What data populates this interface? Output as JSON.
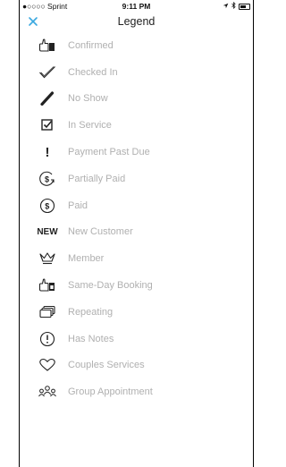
{
  "status_bar": {
    "carrier": "●○○○○ Sprint",
    "time": "9:11 PM"
  },
  "header": {
    "title": "Legend",
    "close_icon": "close-icon"
  },
  "legend": {
    "items": [
      {
        "label": "Confirmed",
        "icon": "thumbs-up-icon"
      },
      {
        "label": "Checked In",
        "icon": "checkmark-icon"
      },
      {
        "label": "No Show",
        "icon": "slash-icon"
      },
      {
        "label": "In Service",
        "icon": "checkbox-icon"
      },
      {
        "label": "Payment Past Due",
        "icon": "exclamation-icon"
      },
      {
        "label": "Partially Paid",
        "icon": "partial-dollar-icon"
      },
      {
        "label": "Paid",
        "icon": "dollar-circle-icon"
      },
      {
        "label": "New Customer",
        "icon": "new-badge-icon",
        "badge": "NEW"
      },
      {
        "label": "Member",
        "icon": "crown-icon"
      },
      {
        "label": "Same-Day Booking",
        "icon": "same-day-thumbs-icon"
      },
      {
        "label": "Repeating",
        "icon": "stacked-cards-icon"
      },
      {
        "label": "Has Notes",
        "icon": "notes-alert-icon"
      },
      {
        "label": "Couples Services",
        "icon": "heart-icon"
      },
      {
        "label": "Group Appointment",
        "icon": "group-people-icon"
      }
    ]
  },
  "colors": {
    "accent": "#3aa8e0",
    "label": "#b0b0b0",
    "icon": "#222222"
  }
}
